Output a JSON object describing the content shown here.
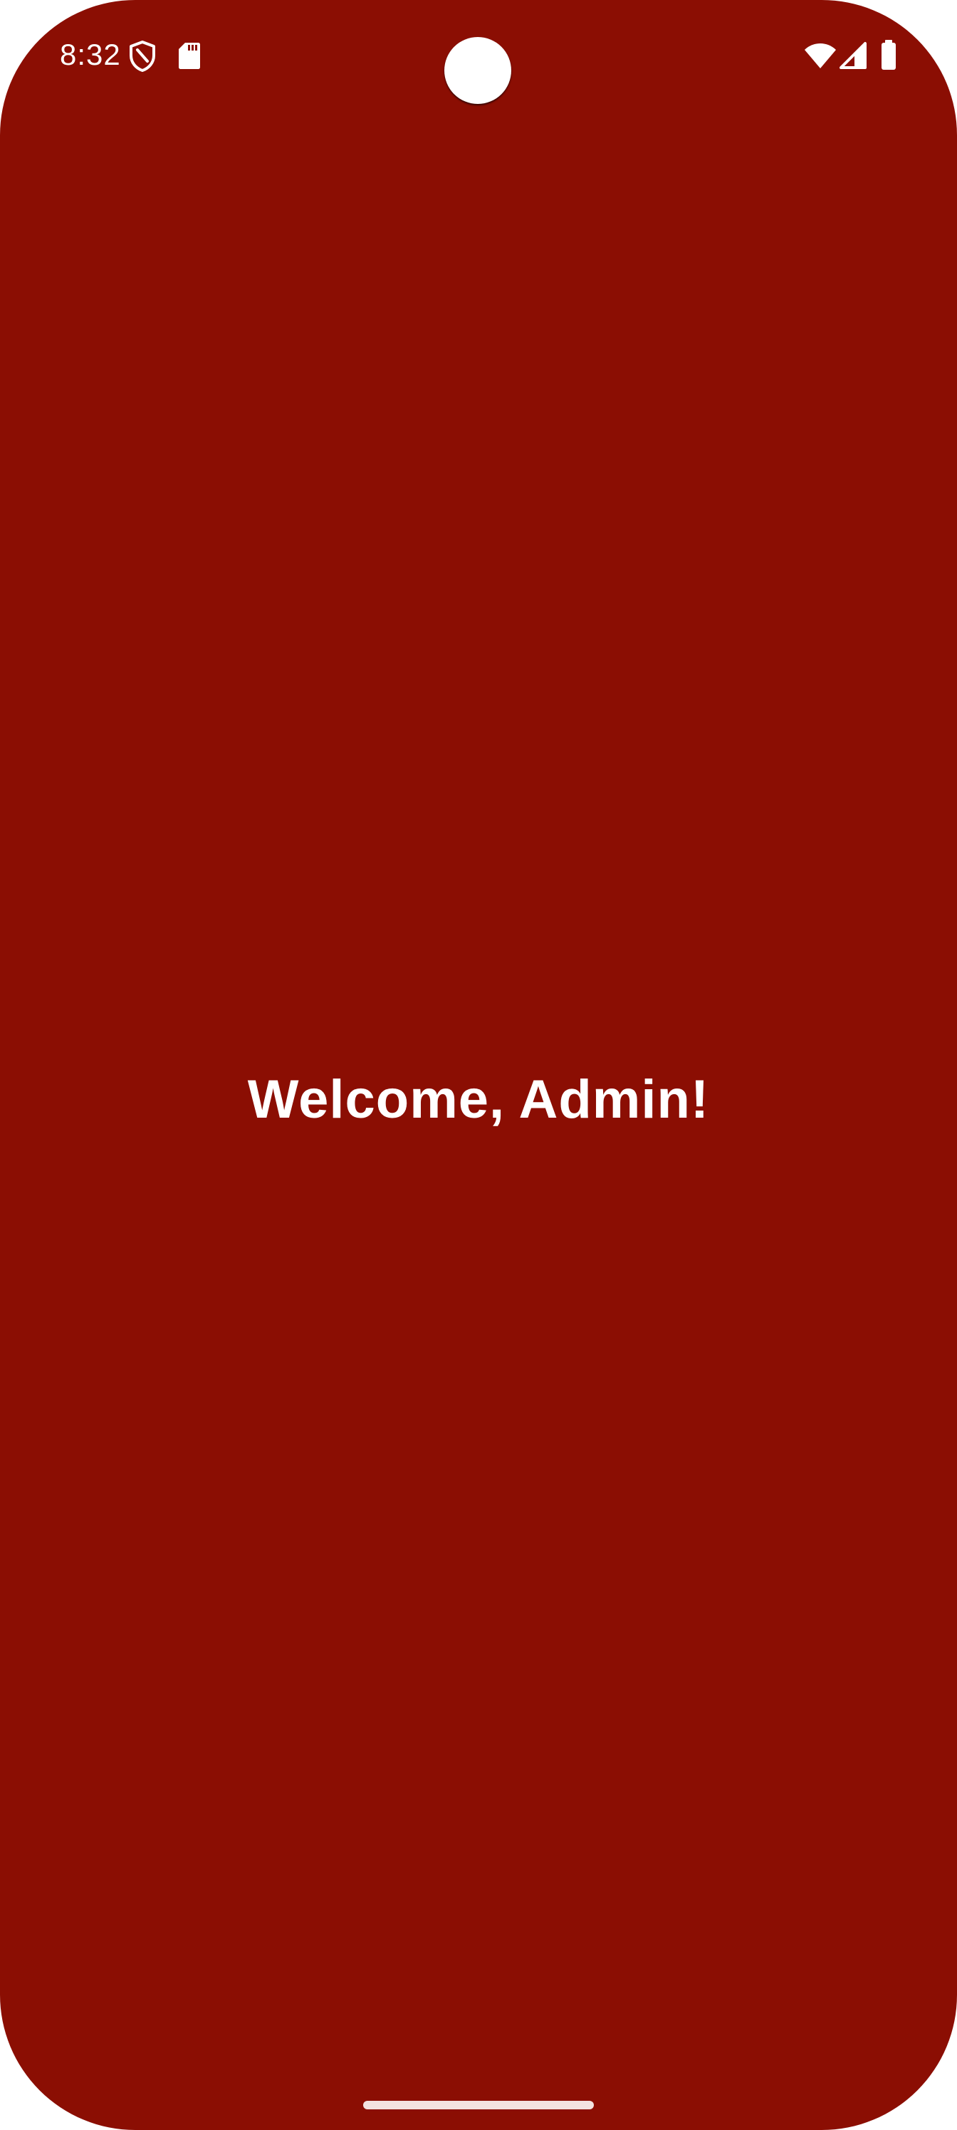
{
  "status_bar": {
    "time": "8:32",
    "left_icons": [
      "shield-icon",
      "sd-card-icon"
    ],
    "right_icons": [
      "wifi-icon",
      "cellular-signal-icon",
      "battery-icon"
    ]
  },
  "screen": {
    "background_color": "#8B0E03",
    "welcome_text": "Welcome, Admin!"
  },
  "navigation": {
    "gesture_bar": "gesture-handle"
  }
}
